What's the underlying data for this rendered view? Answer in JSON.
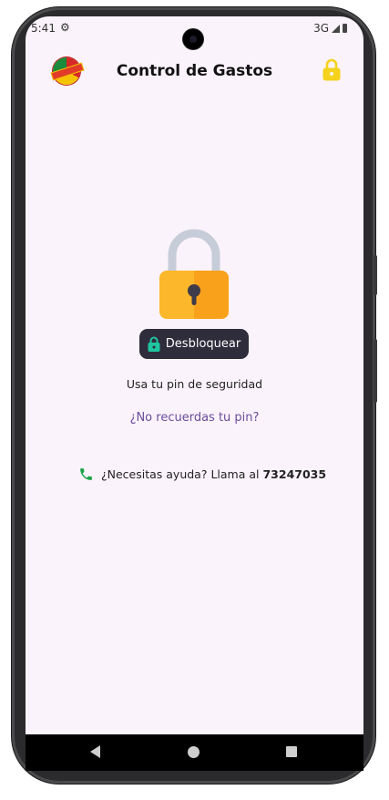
{
  "status_bar": {
    "time": "5:41",
    "network": "3G",
    "settings_icon": "gear-icon",
    "signal_icon": "signal-icon",
    "battery_icon": "battery-icon"
  },
  "app_bar": {
    "title": "Control de Gastos",
    "logo_icon": "bolivia-logo",
    "lock_icon": "lock-icon",
    "lock_color": "#f5d21c"
  },
  "lock_screen": {
    "padlock_icon": "padlock-icon",
    "unlock_button_label": "Desbloquear",
    "unlock_button_icon": "lock-icon",
    "unlock_icon_color": "#1fc6a0",
    "pin_hint": "Usa tu pin de seguridad",
    "forgot_pin_link": "¿No recuerdas tu pin?",
    "help_text_prefix": "¿Necesitas ayuda? Llama al",
    "help_phone": "73247035",
    "help_icon": "phone-icon",
    "help_icon_color": "#1aa34a"
  },
  "nav_bar": {
    "back_icon": "back-icon",
    "home_icon": "home-icon",
    "recents_icon": "recents-icon"
  }
}
